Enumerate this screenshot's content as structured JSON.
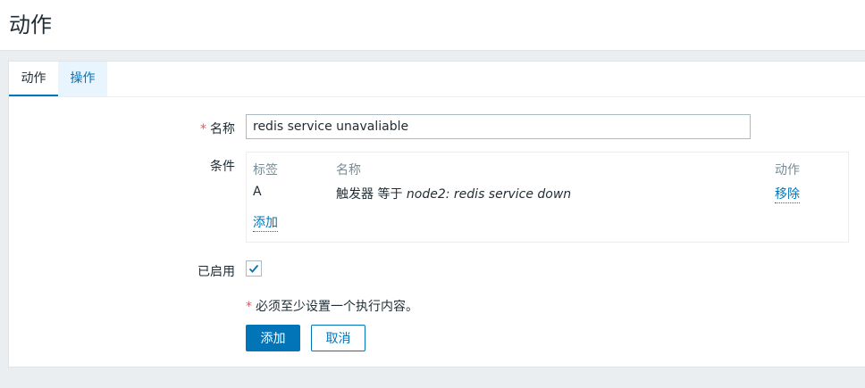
{
  "header": {
    "title": "动作"
  },
  "tabs": [
    {
      "label": "动作",
      "active": true
    },
    {
      "label": "操作",
      "active": false
    }
  ],
  "form": {
    "name": {
      "label": "名称",
      "required_mark": "*",
      "value": "redis service unavaliable"
    },
    "conditions": {
      "label": "条件",
      "columns": {
        "tag": "标签",
        "name": "名称",
        "action": "动作"
      },
      "rows": [
        {
          "tag": "A",
          "prefix": "触发器 等于 ",
          "trigger": "node2: redis service down",
          "action": "移除"
        }
      ],
      "add_link": "添加"
    },
    "enabled": {
      "label": "已启用",
      "checked": true
    },
    "note": {
      "required_mark": "*",
      "text": "必须至少设置一个执行内容。"
    }
  },
  "buttons": {
    "add": "添加",
    "cancel": "取消"
  },
  "colors": {
    "accent": "#0275b8",
    "required": "#e45959",
    "page_bg": "#ebeef0"
  }
}
